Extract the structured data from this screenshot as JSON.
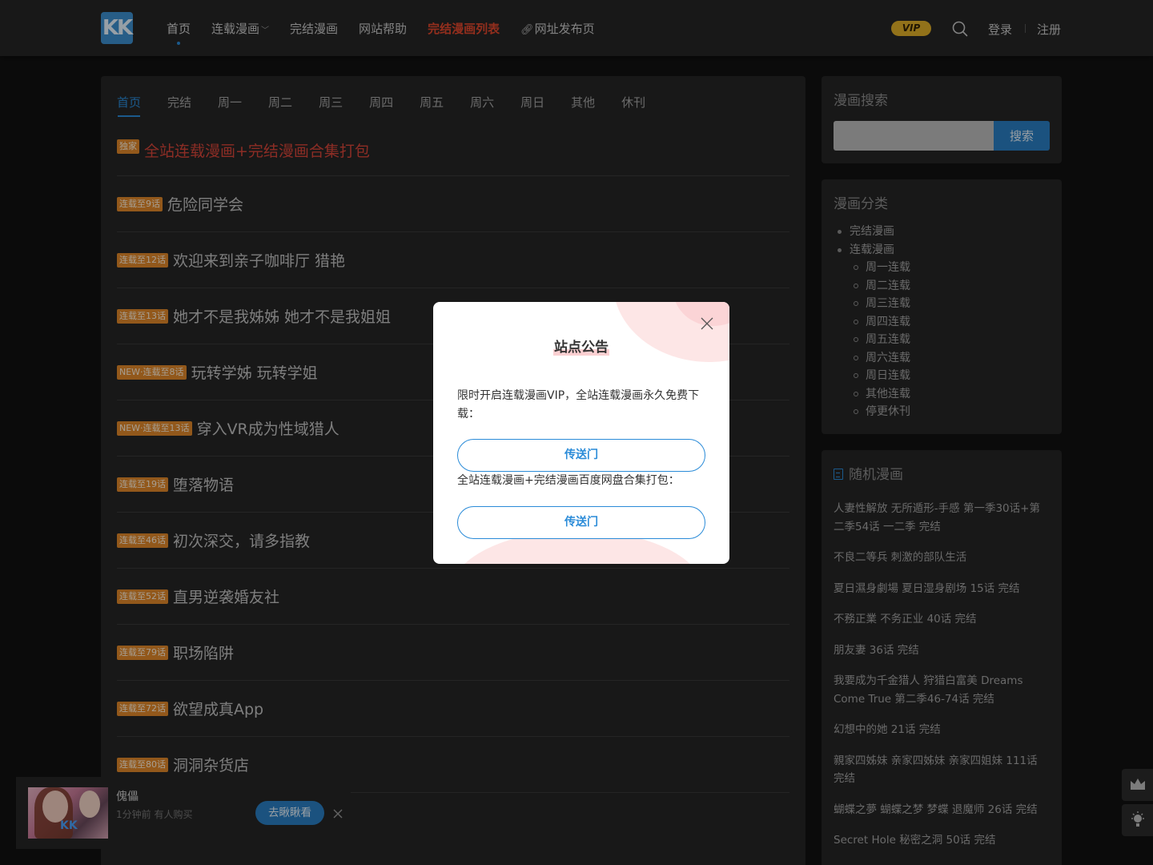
{
  "header": {
    "logo": "KK",
    "nav": [
      {
        "label": "首页",
        "active": true
      },
      {
        "label": "连载漫画",
        "dropdown": true
      },
      {
        "label": "完结漫画"
      },
      {
        "label": "网站帮助"
      },
      {
        "label": "完结漫画列表",
        "hot": true
      },
      {
        "label": "网址发布页",
        "link_icon": true
      }
    ],
    "vip": "VIP",
    "login": "登录",
    "register": "注册"
  },
  "tabs": [
    "首页",
    "完结",
    "周一",
    "周二",
    "周三",
    "周四",
    "周五",
    "周六",
    "周日",
    "其他",
    "休刊"
  ],
  "list": [
    {
      "badge": "独家",
      "title": "全站连载漫画+完结漫画合集打包",
      "featured": true
    },
    {
      "badge": "连载至9话",
      "title": "危险同学会"
    },
    {
      "badge": "连载至12话",
      "title": "欢迎来到亲子咖啡厅 猎艳"
    },
    {
      "badge": "连载至13话",
      "title": "她才不是我姊姊 她才不是我姐姐"
    },
    {
      "badge": "NEW·连载至8话",
      "title": "玩转学姊 玩转学姐"
    },
    {
      "badge": "NEW·连载至13话",
      "title": "穿入VR成为性域猎人"
    },
    {
      "badge": "连载至19话",
      "title": "堕落物语"
    },
    {
      "badge": "连载至46话",
      "title": "初次深交，请多指教"
    },
    {
      "badge": "连载至52话",
      "title": "直男逆袭婚友社"
    },
    {
      "badge": "连载至79话",
      "title": "职场陷阱"
    },
    {
      "badge": "连载至72话",
      "title": "欲望成真App"
    },
    {
      "badge": "连载至80话",
      "title": "洞洞杂货店"
    }
  ],
  "sidebar": {
    "search": {
      "title": "漫画搜索",
      "button": "搜索",
      "placeholder": ""
    },
    "categories": {
      "title": "漫画分类",
      "items": [
        {
          "label": "完结漫画",
          "level": "top"
        },
        {
          "label": "连载漫画",
          "level": "top"
        },
        {
          "label": "周一连载",
          "level": "sub"
        },
        {
          "label": "周二连载",
          "level": "sub"
        },
        {
          "label": "周三连载",
          "level": "sub"
        },
        {
          "label": "周四连载",
          "level": "sub"
        },
        {
          "label": "周五连载",
          "level": "sub"
        },
        {
          "label": "周六连载",
          "level": "sub"
        },
        {
          "label": "周日连载",
          "level": "sub"
        },
        {
          "label": "其他连载",
          "level": "sub"
        },
        {
          "label": "停更休刊",
          "level": "sub"
        }
      ]
    },
    "random": {
      "title": "随机漫画",
      "items": [
        "人妻性解放 无所遁形-手感 第一季30话+第二季54话 一二季 完结",
        "不良二等兵 刺激的部队生活",
        "夏日濕身劇場 夏日湿身剧场 15话 完结",
        "不務正業 不务正业 40话 完结",
        "朋友妻 36话 完结",
        "我要成为千金猎人 狩猎白富美 Dreams Come True 第二季46-74话 完结",
        "幻想中的她 21话 完结",
        "親家四姊妹 亲家四姊妹 亲家四姐妹 111话 完结",
        "蝴蝶之夢 蝴蝶之梦 梦蝶 退魔师 26话 完结",
        "Secret Hole 秘密之洞 50话 完结"
      ]
    }
  },
  "modal": {
    "title": "站点公告",
    "text1": "限时开启连载漫画VIP，全站连载漫画永久免费下载：",
    "button1": "传送门",
    "text2": "全站连载漫画+完结漫画百度网盘合集打包：",
    "button2": "传送门"
  },
  "popup": {
    "name": "傀儡",
    "time": "1分钟前 有人购买",
    "button": "去瞅瞅看"
  },
  "colors": {
    "accent": "#2a8bd8",
    "badge": "#e0882a",
    "hot": "#e2482d",
    "vip": "#e0b029"
  }
}
